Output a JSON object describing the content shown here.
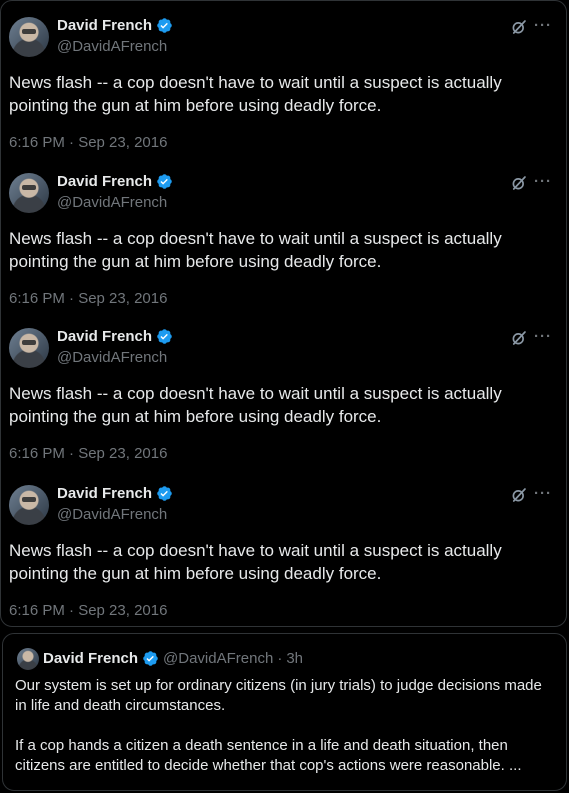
{
  "tweets": [
    {
      "name": "David French",
      "handle": "@DavidAFrench",
      "text": "News flash -- a cop doesn't have to wait until a suspect is actually pointing the gun at him before using deadly force.",
      "time": "6:16 PM · Sep 23, 2016"
    },
    {
      "name": "David French",
      "handle": "@DavidAFrench",
      "text": "News flash -- a cop doesn't have to wait until a suspect is actually pointing the gun at him before using deadly force.",
      "time": "6:16 PM · Sep 23, 2016"
    },
    {
      "name": "David French",
      "handle": "@DavidAFrench",
      "text": "News flash -- a cop doesn't have to wait until a suspect is actually pointing the gun at him before using deadly force.",
      "time": "6:16 PM · Sep 23, 2016"
    },
    {
      "name": "David French",
      "handle": "@DavidAFrench",
      "text": "News flash -- a cop doesn't have to wait until a suspect is actually pointing the gun at him before using deadly force.",
      "time": "6:16 PM · Sep 23, 2016"
    }
  ],
  "quote": {
    "name": "David French",
    "handle": "@DavidAFrench",
    "dot": "·",
    "time": "3h",
    "paragraph1": "Our system is set up for ordinary citizens (in jury trials) to judge decisions made in life and death circumstances.",
    "paragraph2": "If a cop hands a citizen a death sentence in a life and death situation, then citizens are entitled to decide whether that cop's actions were reasonable. ..."
  },
  "icons": {
    "verified": "verified-badge-icon",
    "grok": "grok-icon",
    "more": "more-icon"
  },
  "colors": {
    "background": "#000000",
    "text": "#e7e9ea",
    "muted": "#71767b",
    "verified": "#1d9bf0",
    "border": "#2f3336"
  }
}
